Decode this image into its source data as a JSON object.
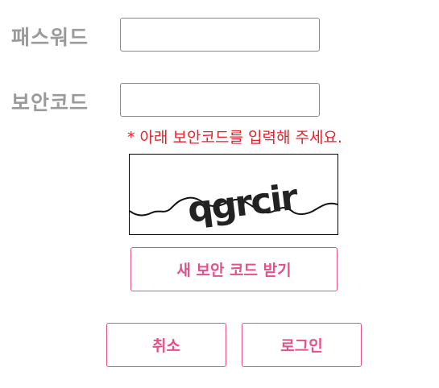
{
  "form": {
    "password_label": "패스워드",
    "password_value": "",
    "security_label": "보안코드",
    "security_value": "",
    "notice": "* 아래 보안코드를 입력해 주세요.",
    "captcha_text": "qgrcir",
    "refresh_label": "새 보안 코드 받기",
    "cancel_label": "취소",
    "login_label": "로그인"
  },
  "colors": {
    "label": "#9a9a9a",
    "notice": "#e8202a",
    "accent": "#e4508a",
    "input_border": "#8a8a8a"
  }
}
